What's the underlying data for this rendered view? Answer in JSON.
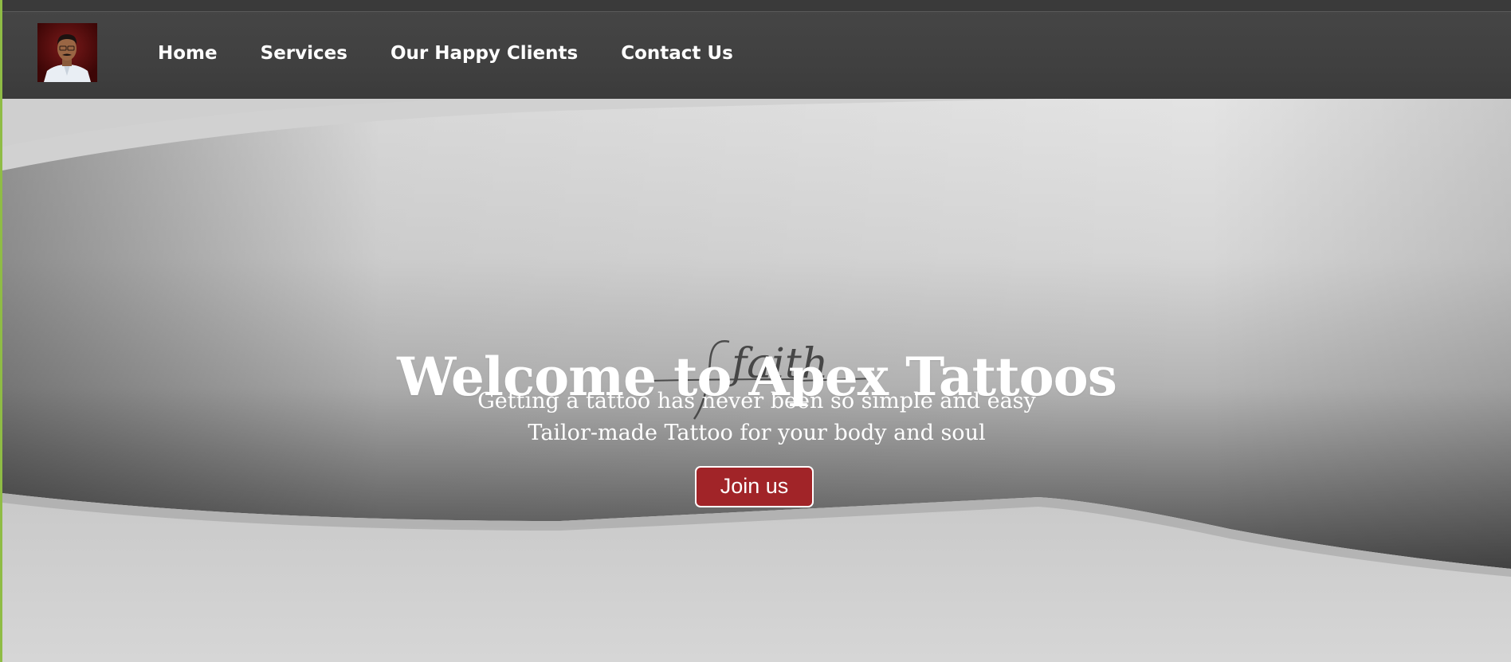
{
  "nav": {
    "logo_alt": "profile-photo",
    "items": [
      {
        "label": "Home"
      },
      {
        "label": "Services"
      },
      {
        "label": "Our Happy Clients"
      },
      {
        "label": "Contact Us"
      }
    ]
  },
  "hero": {
    "title": "Welcome to Apex Tattoos",
    "tattoo_text": "faith",
    "line1": "Getting a tattoo has never been so simple and easy",
    "line2": "Tailor-made Tattoo for your body and soul",
    "cta_label": "Join us"
  },
  "colors": {
    "header_bg": "#424242",
    "cta_bg": "#a12428",
    "accent_edge": "#8fbc45",
    "text": "#ffffff"
  }
}
